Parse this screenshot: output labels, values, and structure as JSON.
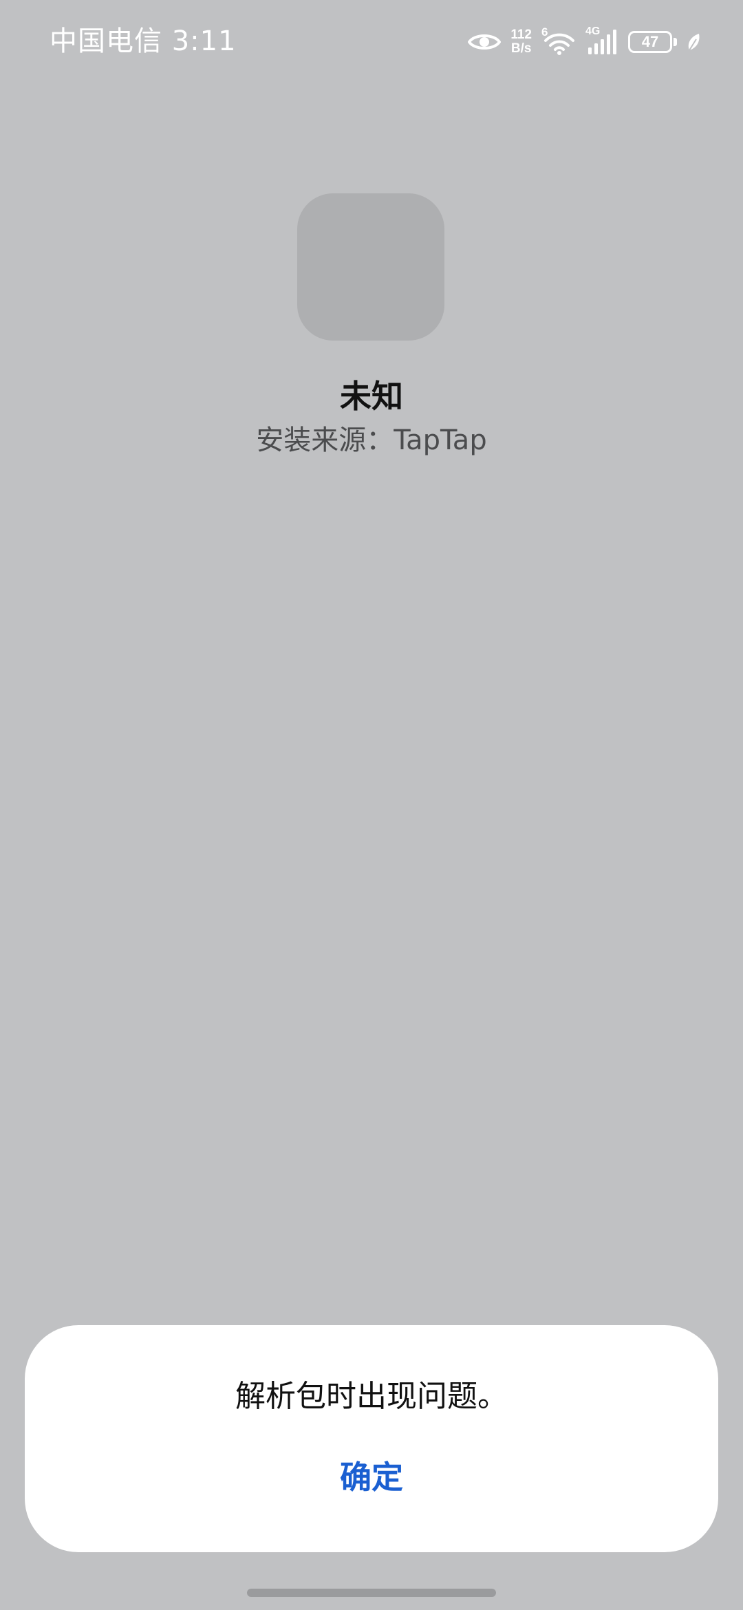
{
  "status_bar": {
    "carrier_time": "中国电信 3:11",
    "network_speed_value": "112",
    "network_speed_unit": "B/s",
    "wifi_label": "6",
    "cellular_label": "4G",
    "battery_level": "47",
    "icons": [
      "eye-icon",
      "wifi-icon",
      "signal-icon",
      "battery-icon",
      "leaf-icon"
    ]
  },
  "app": {
    "name": "未知",
    "source": "安装来源：TapTap"
  },
  "dialog": {
    "message": "解析包时出现问题。",
    "confirm_label": "确定"
  },
  "colors": {
    "background": "#c0c1c3",
    "icon_placeholder": "#aeafb1",
    "dialog_background": "#ffffff",
    "accent": "#1a5fd1"
  }
}
